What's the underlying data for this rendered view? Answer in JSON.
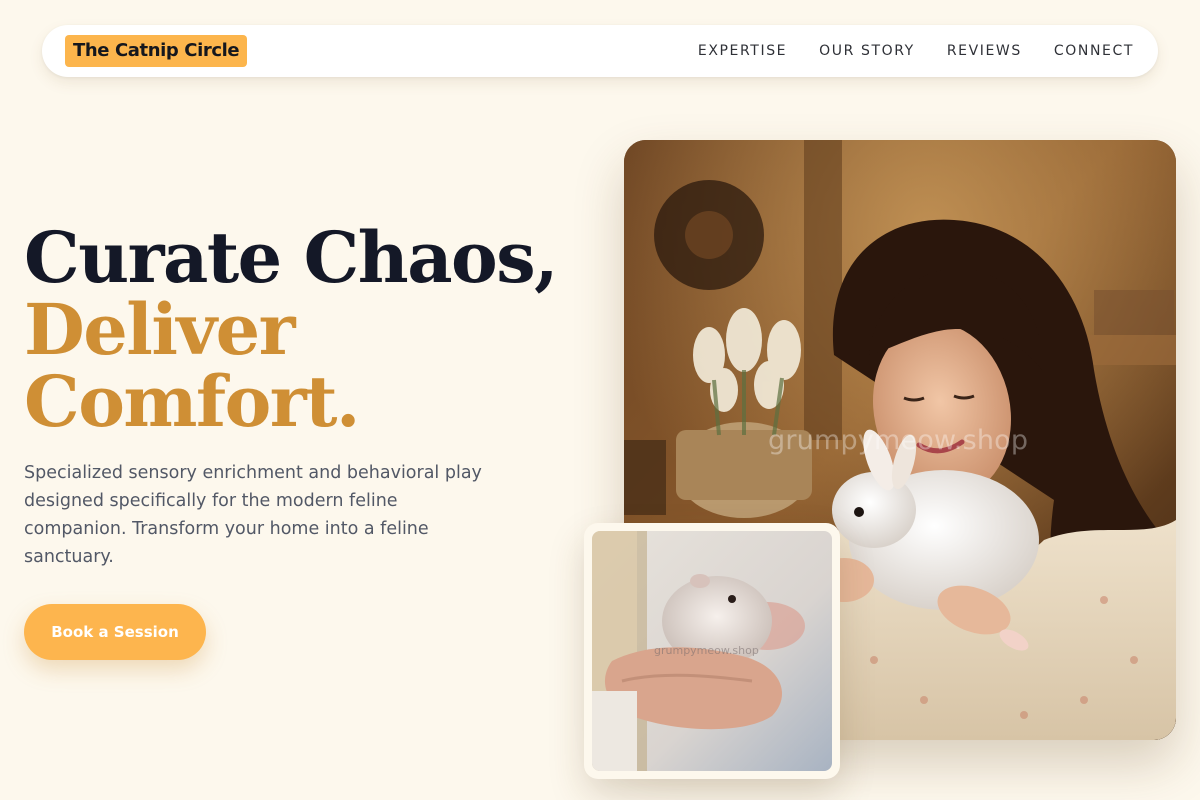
{
  "nav": {
    "brand": "The Catnip Circle",
    "links": [
      "EXPERTISE",
      "OUR STORY",
      "REVIEWS",
      "CONNECT"
    ]
  },
  "hero": {
    "title_line1": "Curate Chaos,",
    "title_line2": "Deliver",
    "title_line3": "Comfort.",
    "description": "Specialized sensory enrichment and behavioral play designed specifically for the modern feline companion. Transform your home into a feline sanctuary.",
    "cta_label": "Book a Session"
  },
  "images": {
    "main_watermark": "grumpymeow.shop",
    "small_watermark": "grumpymeow.shop"
  },
  "colors": {
    "background": "#fdf8ed",
    "accent": "#fcb54c",
    "heading_dark": "#141827",
    "heading_accent": "#cf8f35",
    "body_text": "#525866"
  }
}
